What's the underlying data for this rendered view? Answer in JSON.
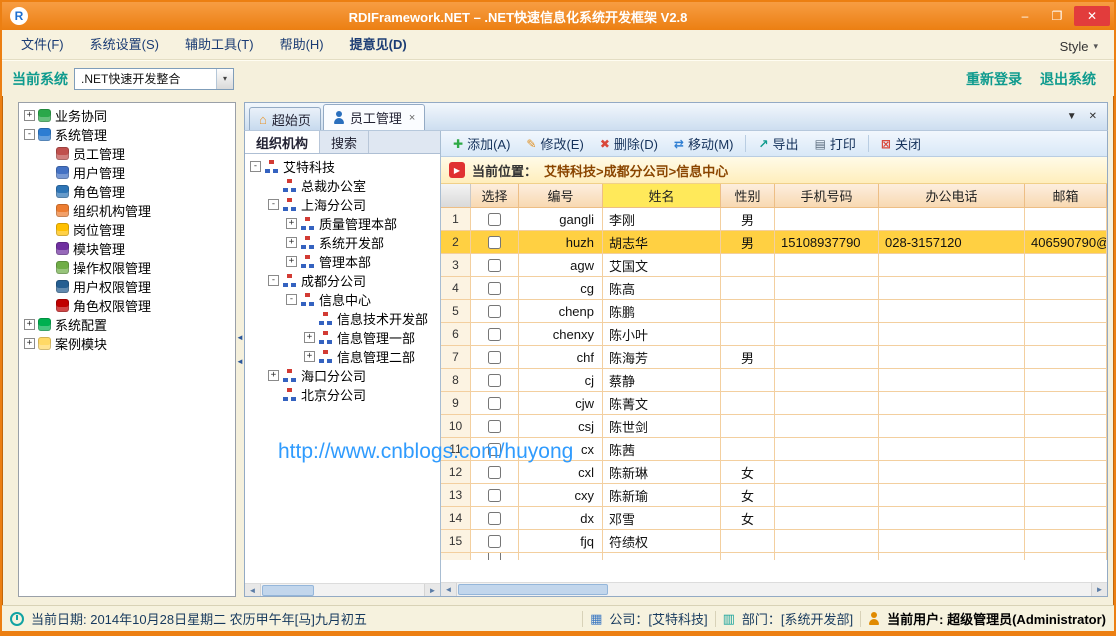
{
  "window": {
    "title": "RDIFramework.NET – .NET快速信息化系统开发框架 V2.8",
    "controls": {
      "minimize": "–",
      "maximize": "❐",
      "close": "✕"
    }
  },
  "menubar": {
    "items": [
      {
        "label": "文件(F)",
        "cls": ""
      },
      {
        "label": "系统设置(S)",
        "cls": ""
      },
      {
        "label": "辅助工具(T)",
        "cls": ""
      },
      {
        "label": "帮助(H)",
        "cls": ""
      },
      {
        "label": "提意见(D)",
        "cls": "emph"
      }
    ],
    "style_label": "Style",
    "style_arrow": "▾"
  },
  "system_bar": {
    "label": "当前系统",
    "dropdown_value": ".NET快速开发整合",
    "dropdown_arrow": "▾",
    "relogin": "重新登录",
    "logout": "退出系统"
  },
  "nav_tree": {
    "items": [
      {
        "label": "业务协同",
        "lv": "lv0",
        "expander": "+",
        "icon": "globe-icon",
        "icon_style": "background:#2aa84a"
      },
      {
        "label": "系统管理",
        "lv": "lv0",
        "expander": "-",
        "icon": "monitor-icon",
        "icon_style": "background:#2d7dd2"
      },
      {
        "label": "员工管理",
        "lv": "lv1",
        "expander": "",
        "icon": "employee-icon",
        "icon_style": "background:#c0504d"
      },
      {
        "label": "用户管理",
        "lv": "lv1",
        "expander": "",
        "icon": "user-icon",
        "icon_style": "background:#4472c4"
      },
      {
        "label": "角色管理",
        "lv": "lv1",
        "expander": "",
        "icon": "role-icon",
        "icon_style": "background:#2e75b6"
      },
      {
        "label": "组织机构管理",
        "lv": "lv1",
        "expander": "",
        "icon": "org-icon",
        "icon_style": "background:#ed7d31"
      },
      {
        "label": "岗位管理",
        "lv": "lv1",
        "expander": "",
        "icon": "position-icon",
        "icon_style": "background:#ffc000"
      },
      {
        "label": "模块管理",
        "lv": "lv1",
        "expander": "",
        "icon": "module-icon",
        "icon_style": "background:#7030a0"
      },
      {
        "label": "操作权限管理",
        "lv": "lv1",
        "expander": "",
        "icon": "operation-permission-icon",
        "icon_style": "background:#70ad47"
      },
      {
        "label": "用户权限管理",
        "lv": "lv1",
        "expander": "",
        "icon": "user-permission-icon",
        "icon_style": "background:#255e91"
      },
      {
        "label": "角色权限管理",
        "lv": "lv1",
        "expander": "",
        "icon": "role-permission-icon",
        "icon_style": "background:#c00000"
      },
      {
        "label": "系统配置",
        "lv": "lv0",
        "expander": "+",
        "icon": "config-icon",
        "icon_style": "background:#00b050"
      },
      {
        "label": "案例模块",
        "lv": "lv0",
        "expander": "+",
        "icon": "demo-icon",
        "icon_style": "background:#ffd966"
      }
    ]
  },
  "doc_tabs": {
    "tabs": [
      {
        "label": "超始页",
        "cls": "",
        "icon": "home-icon",
        "close": ""
      },
      {
        "label": "员工管理",
        "cls": "active",
        "icon": "person-icon",
        "close": "×"
      }
    ],
    "list_button": "▼",
    "close_button": "✕"
  },
  "org_panel": {
    "tabs": [
      {
        "label": "组织机构",
        "cls": "active"
      },
      {
        "label": "搜索",
        "cls": ""
      }
    ],
    "tree": {
      "items": [
        {
          "label": "艾特科技",
          "lv": "lv0",
          "expander": "-",
          "cls": ""
        },
        {
          "label": "总裁办公室",
          "lv": "lv1",
          "expander": "",
          "cls": ""
        },
        {
          "label": "上海分公司",
          "lv": "lv1",
          "expander": "-",
          "cls": ""
        },
        {
          "label": "质量管理本部",
          "lv": "lv2",
          "expander": "+",
          "cls": ""
        },
        {
          "label": "系统开发部",
          "lv": "lv2",
          "expander": "+",
          "cls": ""
        },
        {
          "label": "管理本部",
          "lv": "lv2",
          "expander": "+",
          "cls": ""
        },
        {
          "label": "成都分公司",
          "lv": "lv1",
          "expander": "-",
          "cls": ""
        },
        {
          "label": "信息中心",
          "lv": "lv2",
          "expander": "-",
          "cls": "checked"
        },
        {
          "label": "信息技术开发部",
          "lv": "lv3",
          "expander": "",
          "cls": ""
        },
        {
          "label": "信息管理一部",
          "lv": "lv3",
          "expander": "+",
          "cls": ""
        },
        {
          "label": "信息管理二部",
          "lv": "lv3",
          "expander": "+",
          "cls": ""
        },
        {
          "label": "海口分公司",
          "lv": "lv1",
          "expander": "+",
          "cls": ""
        },
        {
          "label": "北京分公司",
          "lv": "lv1",
          "expander": "",
          "cls": ""
        }
      ]
    }
  },
  "toolbar": {
    "group1": [
      {
        "label": "添加(A)",
        "glyph": "✚",
        "icon": "add-icon",
        "icon_style": "color:#2daa46"
      },
      {
        "label": "修改(E)",
        "glyph": "✎",
        "icon": "edit-icon",
        "icon_style": "color:#e08f1f"
      },
      {
        "label": "删除(D)",
        "glyph": "✖",
        "icon": "delete-icon",
        "icon_style": "color:#d9483b"
      },
      {
        "label": "移动(M)",
        "glyph": "⇄",
        "icon": "move-icon",
        "icon_style": "color:#2d7dd2"
      }
    ],
    "group2": [
      {
        "label": "导出",
        "glyph": "↗",
        "icon": "export-icon",
        "icon_style": "color:#0f9b8e"
      },
      {
        "label": "打印",
        "glyph": "▤",
        "icon": "print-icon",
        "icon_style": "color:#5a6b7d"
      }
    ],
    "group3": [
      {
        "label": "关闭",
        "glyph": "⊠",
        "icon": "close-icon",
        "icon_style": "color:#d9483b"
      }
    ]
  },
  "location_bar": {
    "label": "当前位置：",
    "path": "艾特科技>成都分公司>信息中心",
    "arrow_glyph": "▶"
  },
  "grid": {
    "columns": [
      "选择",
      "编号",
      "姓名",
      "性别",
      "手机号码",
      "办公电话",
      "邮箱"
    ],
    "rows": [
      {
        "no": "1",
        "id": "gangli",
        "name": "李刚",
        "gender": "男",
        "mobile": "",
        "phone": "",
        "email": "",
        "cls": ""
      },
      {
        "no": "2",
        "id": "huzh",
        "name": "胡志华",
        "gender": "男",
        "mobile": "15108937790",
        "phone": "028-3157120",
        "email": "406590790@",
        "cls": "sel-row"
      },
      {
        "no": "3",
        "id": "agw",
        "name": "艾国文",
        "gender": "",
        "mobile": "",
        "phone": "",
        "email": "",
        "cls": ""
      },
      {
        "no": "4",
        "id": "cg",
        "name": "陈高",
        "gender": "",
        "mobile": "",
        "phone": "",
        "email": "",
        "cls": ""
      },
      {
        "no": "5",
        "id": "chenp",
        "name": "陈鹏",
        "gender": "",
        "mobile": "",
        "phone": "",
        "email": "",
        "cls": ""
      },
      {
        "no": "6",
        "id": "chenxy",
        "name": "陈小叶",
        "gender": "",
        "mobile": "",
        "phone": "",
        "email": "",
        "cls": ""
      },
      {
        "no": "7",
        "id": "chf",
        "name": "陈海芳",
        "gender": "男",
        "mobile": "",
        "phone": "",
        "email": "",
        "cls": ""
      },
      {
        "no": "8",
        "id": "cj",
        "name": "蔡静",
        "gender": "",
        "mobile": "",
        "phone": "",
        "email": "",
        "cls": ""
      },
      {
        "no": "9",
        "id": "cjw",
        "name": "陈菁文",
        "gender": "",
        "mobile": "",
        "phone": "",
        "email": "",
        "cls": ""
      },
      {
        "no": "10",
        "id": "csj",
        "name": "陈世剑",
        "gender": "",
        "mobile": "",
        "phone": "",
        "email": "",
        "cls": ""
      },
      {
        "no": "11",
        "id": "cx",
        "name": "陈茜",
        "gender": "",
        "mobile": "",
        "phone": "",
        "email": "",
        "cls": ""
      },
      {
        "no": "12",
        "id": "cxl",
        "name": "陈新琳",
        "gender": "女",
        "mobile": "",
        "phone": "",
        "email": "",
        "cls": ""
      },
      {
        "no": "13",
        "id": "cxy",
        "name": "陈新瑜",
        "gender": "女",
        "mobile": "",
        "phone": "",
        "email": "",
        "cls": ""
      },
      {
        "no": "14",
        "id": "dx",
        "name": "邓雪",
        "gender": "女",
        "mobile": "",
        "phone": "",
        "email": "",
        "cls": ""
      },
      {
        "no": "15",
        "id": "fjq",
        "name": "符绩权",
        "gender": "",
        "mobile": "",
        "phone": "",
        "email": "",
        "cls": ""
      },
      {
        "no": "",
        "id": "",
        "name": "",
        "gender": "",
        "mobile": "",
        "phone": "",
        "email": "",
        "cls": "partial"
      }
    ]
  },
  "watermark": "http://www.cnblogs.com/huyong",
  "statusbar": {
    "date": "当前日期: 2014年10月28日星期二 农历甲午年[马]九月初五",
    "company": "公司：[艾特科技]",
    "department": "部门：[系统开发部]",
    "user": "当前用户: 超级管理员(Administrator)"
  }
}
